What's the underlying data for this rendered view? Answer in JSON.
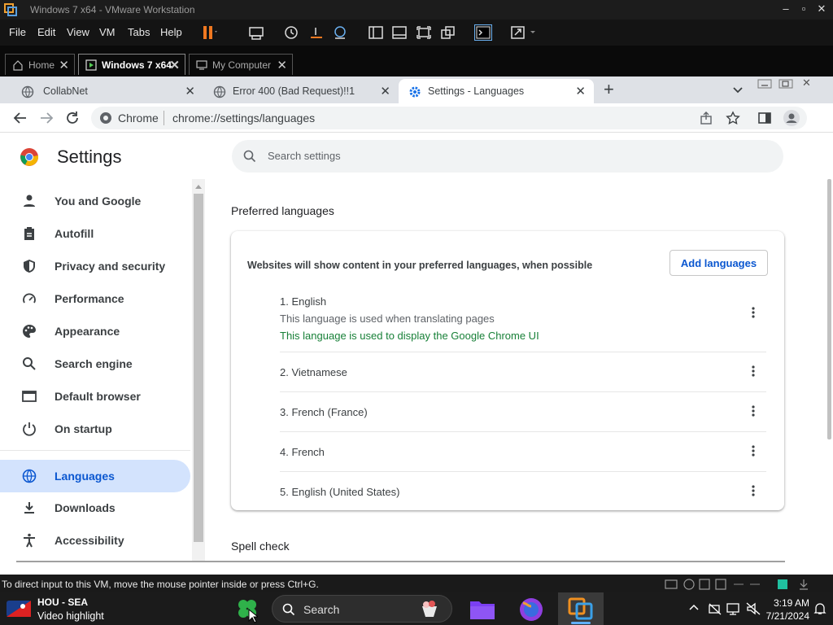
{
  "vmware": {
    "title": "Windows 7 x64 - VMware Workstation",
    "menu": [
      "File",
      "Edit",
      "View",
      "VM",
      "Tabs",
      "Help"
    ],
    "tabs": [
      {
        "label": "Home"
      },
      {
        "label": "Windows 7 x64"
      },
      {
        "label": "My Computer"
      }
    ],
    "status_text": "To direct input to this VM, move the mouse pointer inside or press Ctrl+G."
  },
  "chrome": {
    "tabs": [
      {
        "label": "CollabNet"
      },
      {
        "label": "Error 400 (Bad Request)!!1"
      },
      {
        "label": "Settings - Languages"
      }
    ],
    "new_tab_label": "+",
    "url_site": "Chrome",
    "url_path": "chrome://settings/languages"
  },
  "settings": {
    "title": "Settings",
    "search_placeholder": "Search settings",
    "nav": [
      {
        "label": "You and Google",
        "icon": "person-icon"
      },
      {
        "label": "Autofill",
        "icon": "clipboard-icon"
      },
      {
        "label": "Privacy and security",
        "icon": "shield-icon"
      },
      {
        "label": "Performance",
        "icon": "speedometer-icon"
      },
      {
        "label": "Appearance",
        "icon": "palette-icon"
      },
      {
        "label": "Search engine",
        "icon": "search-icon"
      },
      {
        "label": "Default browser",
        "icon": "browser-icon"
      },
      {
        "label": "On startup",
        "icon": "power-icon"
      },
      {
        "label": "Languages",
        "icon": "globe-icon"
      },
      {
        "label": "Downloads",
        "icon": "download-icon"
      },
      {
        "label": "Accessibility",
        "icon": "accessibility-icon"
      }
    ],
    "section_title": "Preferred languages",
    "card_description": "Websites will show content in your preferred languages, when possible",
    "add_languages_label": "Add languages",
    "languages": [
      {
        "label": "1. English",
        "note1": "This language is used when translating pages",
        "note2": "This language is used to display the Google Chrome UI"
      },
      {
        "label": "2. Vietnamese"
      },
      {
        "label": "3. French (France)"
      },
      {
        "label": "4. French"
      },
      {
        "label": "5. English (United States)"
      }
    ],
    "spell_check_title": "Spell check",
    "accent_color": "#0b57d0",
    "green_note_color": "#188038"
  },
  "taskbar": {
    "weather_line1": "HOU - SEA",
    "weather_line2": "Video highlight",
    "search_label": "Search",
    "time": "3:19 AM",
    "date": "7/21/2024"
  }
}
